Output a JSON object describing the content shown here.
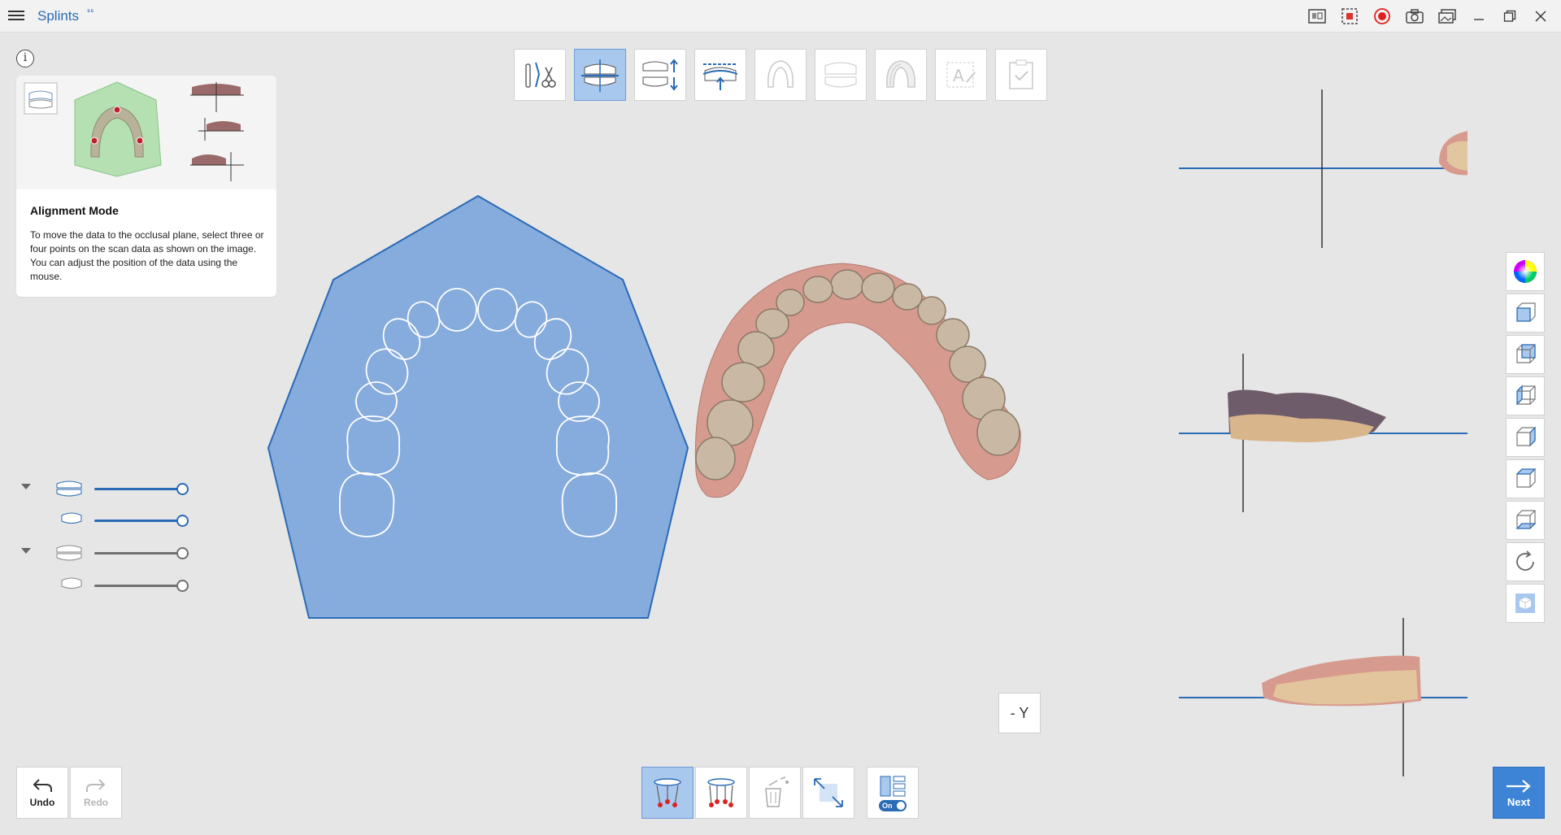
{
  "app": {
    "title": "Splints",
    "badge": "⁵⁵"
  },
  "titlebar_icons": [
    "splints-report-icon",
    "capture-region-icon",
    "record-icon",
    "camera-icon",
    "gallery-icon"
  ],
  "info": {
    "icon_glyph": "i",
    "title": "Alignment Mode",
    "description": "To move the data to the occlusal plane, select three or four points on the scan data as shown on the image. You can adjust the position of the data using the mouse."
  },
  "toolbar": {
    "steps": [
      {
        "name": "prepare-tools-step",
        "state": "normal"
      },
      {
        "name": "alignment-step",
        "state": "active"
      },
      {
        "name": "bite-adjust-step",
        "state": "normal"
      },
      {
        "name": "insertion-direction-step",
        "state": "normal"
      },
      {
        "name": "splint-outline-step",
        "state": "disabled"
      },
      {
        "name": "splint-thickness-step",
        "state": "disabled"
      },
      {
        "name": "splint-design-step",
        "state": "disabled"
      },
      {
        "name": "text-label-step",
        "state": "disabled"
      },
      {
        "name": "finish-step",
        "state": "disabled"
      }
    ]
  },
  "visibility": {
    "rows": [
      {
        "name": "upper-jaw-group",
        "value": 1.0,
        "active": true,
        "has_caret": true
      },
      {
        "name": "upper-jaw-scan",
        "value": 1.0,
        "active": true,
        "has_caret": false
      },
      {
        "name": "lower-jaw-group",
        "value": 1.0,
        "active": false,
        "has_caret": true
      },
      {
        "name": "lower-jaw-scan",
        "value": 1.0,
        "active": false,
        "has_caret": false
      }
    ]
  },
  "axis_label": "- Y",
  "bottom": {
    "undo_label": "Undo",
    "redo_label": "Redo",
    "next_label": "Next",
    "toggle_label": "On"
  },
  "colors": {
    "accent": "#2a6bb5",
    "active_bg": "#a9c8ee",
    "guide_fill": "#86abdd",
    "next_bg": "#3d83d6",
    "record_red": "#e02020"
  }
}
